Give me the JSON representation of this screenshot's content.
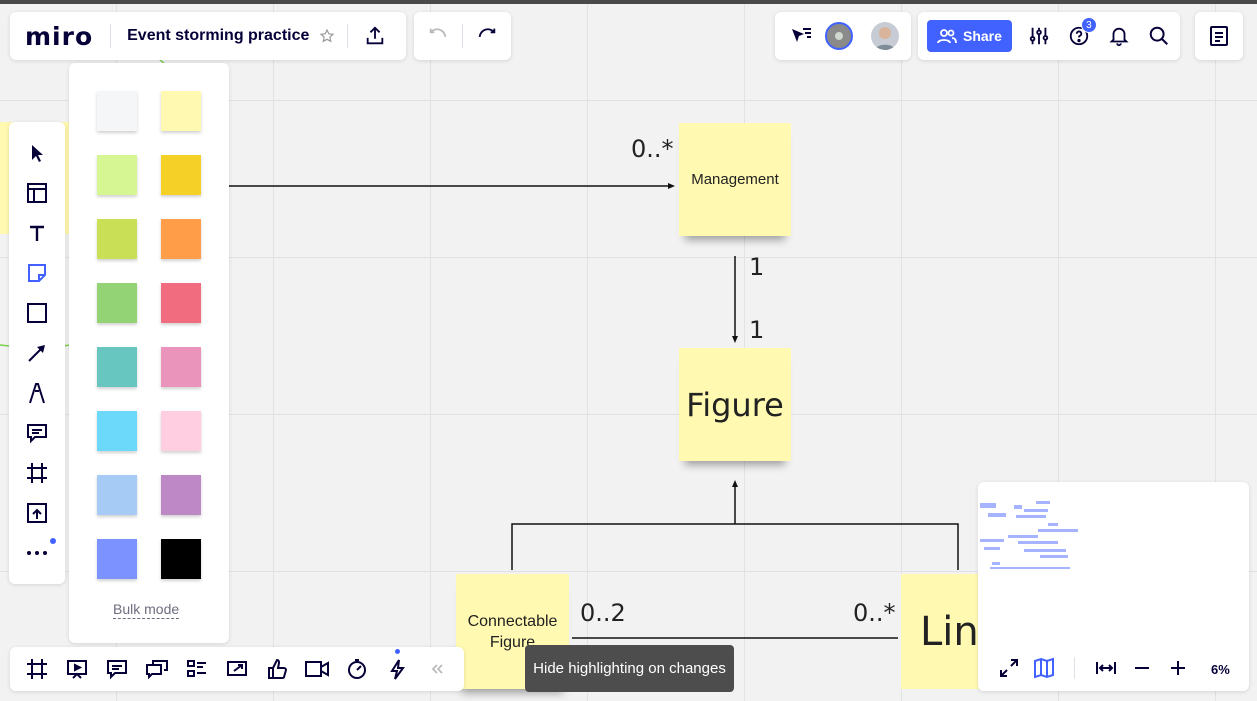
{
  "app": {
    "logo": "miro",
    "board_title": "Event storming practice"
  },
  "topbar": {
    "share_label": "Share",
    "help_badge": "3"
  },
  "board": {
    "stickies": {
      "management": "Management",
      "figure": "Figure",
      "connectable": "Connectable Figure",
      "line": "Line"
    },
    "multiplicities": {
      "management_star": "0..*",
      "figure_top_1": "1",
      "figure_bottom_1": "1",
      "connectable_0_2": "0..2",
      "line_star": "0..*"
    }
  },
  "sticky_palette": {
    "colors": [
      "#f5f6f8",
      "#fff9b1",
      "#d5f692",
      "#f5d128",
      "#c9df56",
      "#ff9d48",
      "#93d275",
      "#f16c7f",
      "#67c6c0",
      "#ea94bb",
      "#6cd8fa",
      "#ffcee0",
      "#a6ccf5",
      "#be88c7",
      "#7b92ff",
      "#000000"
    ],
    "bulk_mode_label": "Bulk mode"
  },
  "tooltip": "Hide highlighting on changes",
  "minimap": {
    "zoom": "6%"
  },
  "colors": {
    "accent": "#4262ff",
    "sticky_yellow": "#fff9b1"
  }
}
